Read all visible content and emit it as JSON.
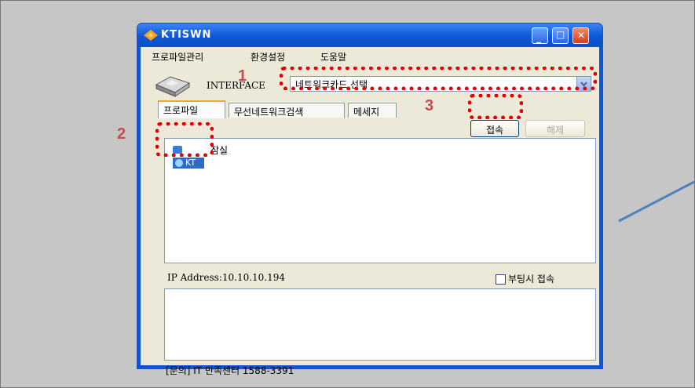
{
  "window": {
    "title": "KTISWN",
    "controls": [
      "minimize",
      "maximize",
      "close"
    ]
  },
  "menu": [
    "프로파일관리",
    "환경설정",
    "도움말"
  ],
  "interface": {
    "label": "INTERFACE",
    "selected": "네트워크카드 선택"
  },
  "tabs": [
    "프로파일",
    "무선네트워크검색",
    "메세지"
  ],
  "buttons": {
    "connect": "접속",
    "disconnect": "해제"
  },
  "profile_list": {
    "group": "잠실",
    "selected_item": "KT"
  },
  "ip_address": "IP Address:10.10.10.194",
  "auto_connect_label": "부팅시 접속",
  "auto_connect_checked": false,
  "footer": "[문의] IT 만족센터 1588-3391",
  "annotations": [
    "1",
    "2",
    "3"
  ],
  "colors": {
    "highlight": "#e00000",
    "annotation_number": "#c0504d",
    "arrow": "#4f81bd"
  }
}
